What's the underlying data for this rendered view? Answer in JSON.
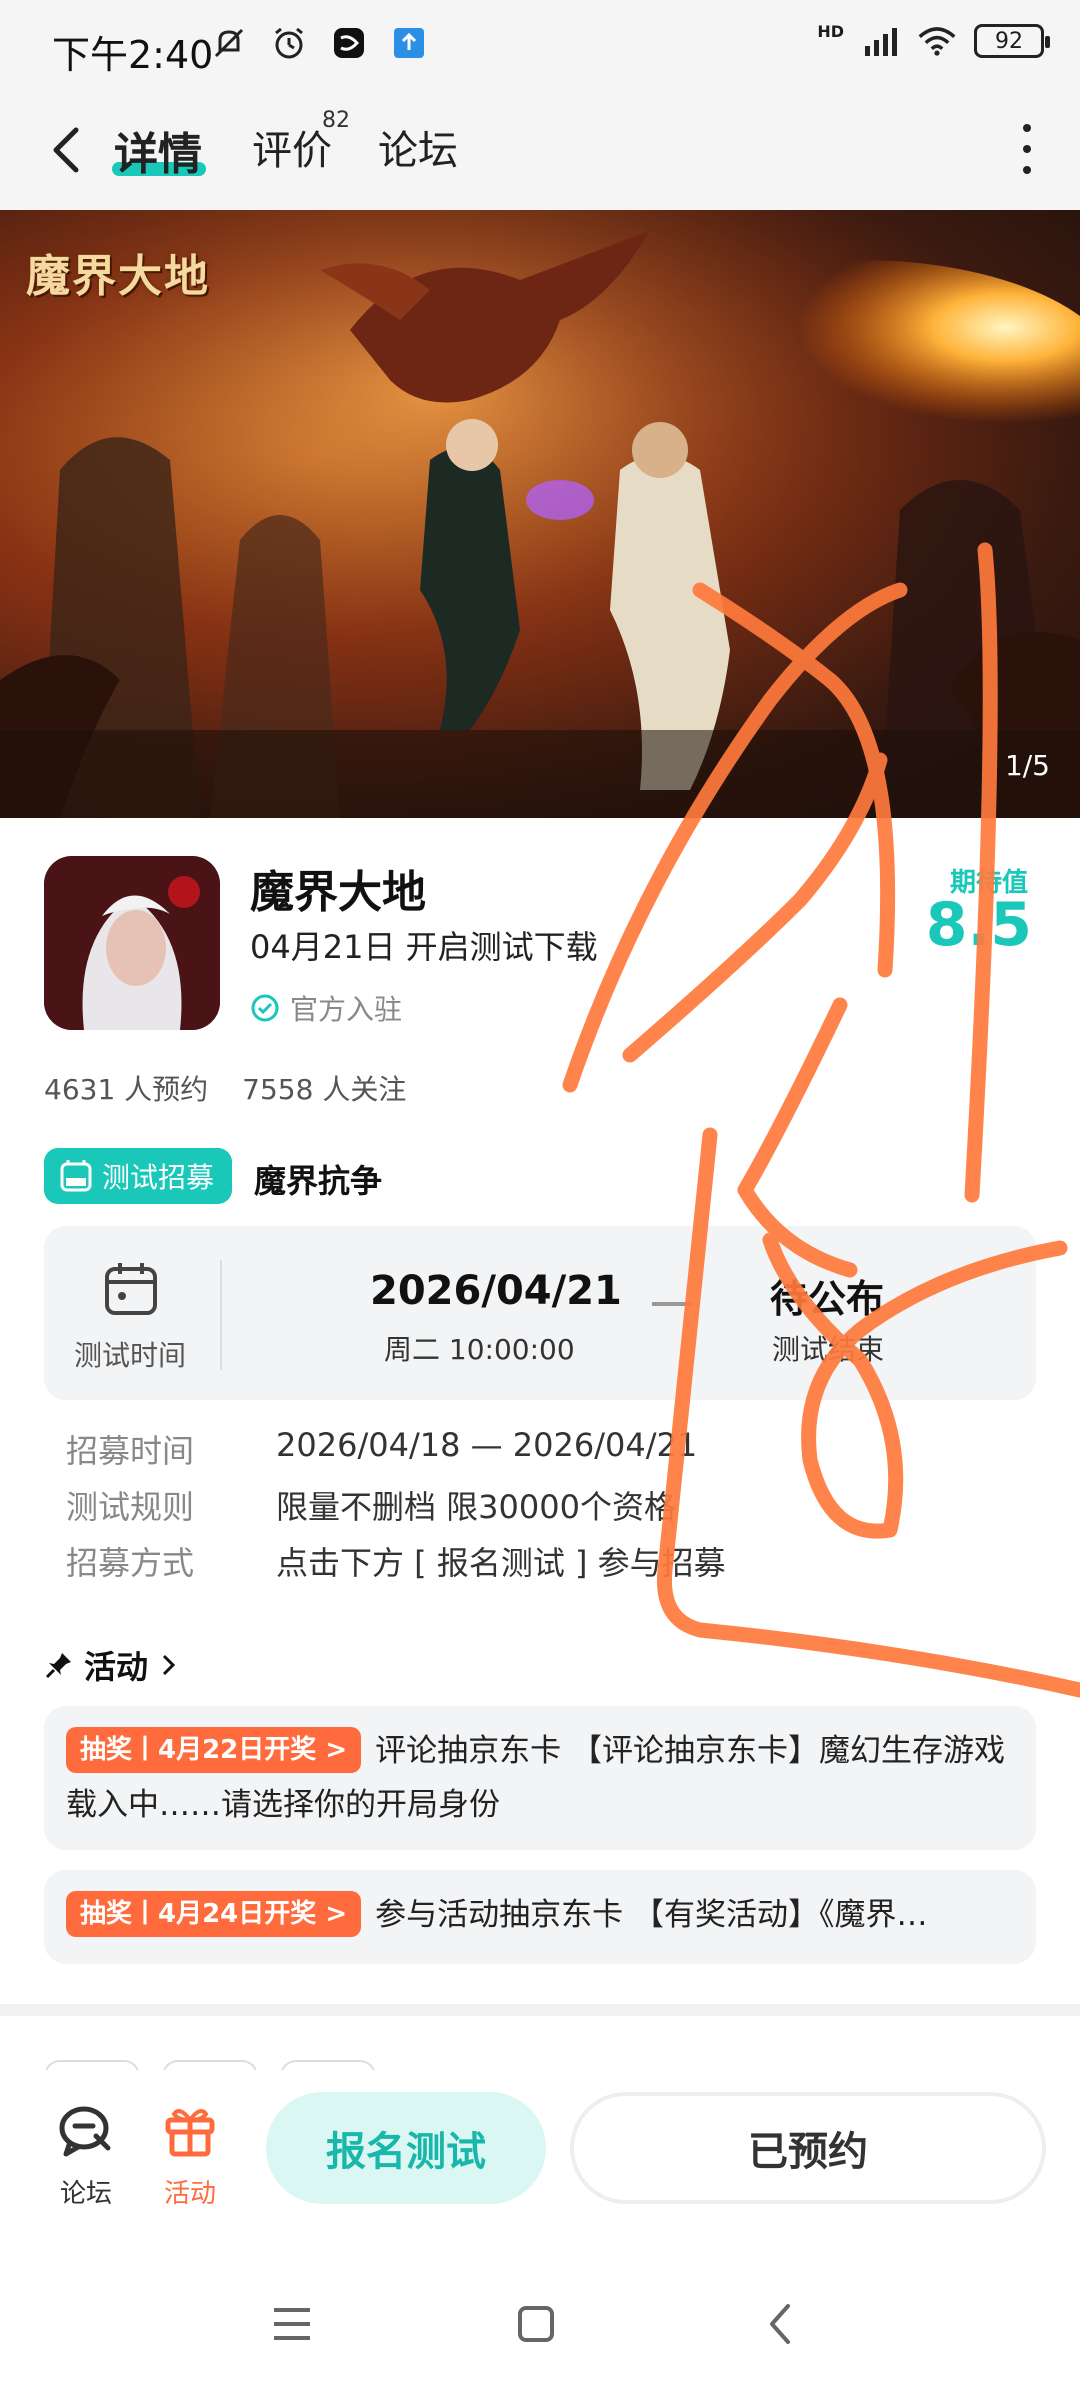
{
  "status_bar": {
    "time": "下午2:40",
    "battery": "92",
    "network": "HD",
    "icons": [
      "mute-icon",
      "alarm-icon",
      "app-notification-icon",
      "upload-icon",
      "signal-icon",
      "wifi-icon",
      "battery-icon"
    ]
  },
  "nav": {
    "tabs": [
      {
        "label": "详情",
        "active": true
      },
      {
        "label": "评价",
        "badge": "82"
      },
      {
        "label": "论坛"
      }
    ]
  },
  "banner": {
    "logo_text": "魔界大地",
    "counter": "1/5"
  },
  "app": {
    "name": "魔界大地",
    "subtitle": "04月21日 开启测试下载",
    "official": "官方入驻",
    "expect_label": "期待值",
    "expect_value": "8.5",
    "reservations": "4631 人预约",
    "followers": "7558 人关注"
  },
  "recruit": {
    "tag": "测试招募",
    "name": "魔界抗争",
    "test_time_label": "测试时间",
    "start_date": "2026/04/21",
    "start_time": "周二  10:00:00",
    "end_value": "待公布",
    "end_label": "测试结束",
    "rows": [
      {
        "key": "招募时间",
        "value": "2026/04/18 — 2026/04/21"
      },
      {
        "key": "测试规则",
        "value": "限量不删档 限30000个资格"
      },
      {
        "key": "招募方式",
        "value": "点击下方 [ 报名测试 ] 参与招募"
      }
    ]
  },
  "activity": {
    "header": "活动",
    "items": [
      {
        "tag": "抽奖丨4月22日开奖 >",
        "text": "评论抽京东卡 【评论抽京东卡】魔幻生存游戏载入中……请选择你的开局身份"
      },
      {
        "tag": "抽奖丨4月24日开奖 >",
        "text": "参与活动抽京东卡 【有奖活动】《魔界…"
      }
    ]
  },
  "bottom_bar": {
    "forum_label": "论坛",
    "activity_label": "活动",
    "signup_label": "报名测试",
    "reserved_label": "已预约"
  },
  "colors": {
    "accent": "#19c8b9",
    "lottery": "#ff6b3d",
    "scribble": "#ff7a3c"
  }
}
